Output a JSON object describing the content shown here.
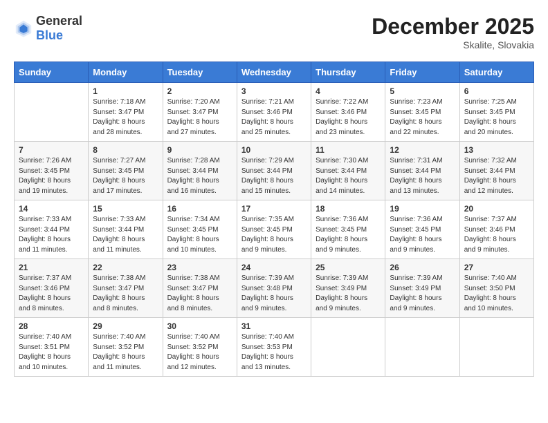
{
  "logo": {
    "general": "General",
    "blue": "Blue"
  },
  "header": {
    "month_year": "December 2025",
    "location": "Skalite, Slovakia"
  },
  "weekdays": [
    "Sunday",
    "Monday",
    "Tuesday",
    "Wednesday",
    "Thursday",
    "Friday",
    "Saturday"
  ],
  "weeks": [
    [
      {
        "day": "",
        "sunrise": "",
        "sunset": "",
        "daylight": ""
      },
      {
        "day": "1",
        "sunrise": "Sunrise: 7:18 AM",
        "sunset": "Sunset: 3:47 PM",
        "daylight": "Daylight: 8 hours and 28 minutes."
      },
      {
        "day": "2",
        "sunrise": "Sunrise: 7:20 AM",
        "sunset": "Sunset: 3:47 PM",
        "daylight": "Daylight: 8 hours and 27 minutes."
      },
      {
        "day": "3",
        "sunrise": "Sunrise: 7:21 AM",
        "sunset": "Sunset: 3:46 PM",
        "daylight": "Daylight: 8 hours and 25 minutes."
      },
      {
        "day": "4",
        "sunrise": "Sunrise: 7:22 AM",
        "sunset": "Sunset: 3:46 PM",
        "daylight": "Daylight: 8 hours and 23 minutes."
      },
      {
        "day": "5",
        "sunrise": "Sunrise: 7:23 AM",
        "sunset": "Sunset: 3:45 PM",
        "daylight": "Daylight: 8 hours and 22 minutes."
      },
      {
        "day": "6",
        "sunrise": "Sunrise: 7:25 AM",
        "sunset": "Sunset: 3:45 PM",
        "daylight": "Daylight: 8 hours and 20 minutes."
      }
    ],
    [
      {
        "day": "7",
        "sunrise": "Sunrise: 7:26 AM",
        "sunset": "Sunset: 3:45 PM",
        "daylight": "Daylight: 8 hours and 19 minutes."
      },
      {
        "day": "8",
        "sunrise": "Sunrise: 7:27 AM",
        "sunset": "Sunset: 3:45 PM",
        "daylight": "Daylight: 8 hours and 17 minutes."
      },
      {
        "day": "9",
        "sunrise": "Sunrise: 7:28 AM",
        "sunset": "Sunset: 3:44 PM",
        "daylight": "Daylight: 8 hours and 16 minutes."
      },
      {
        "day": "10",
        "sunrise": "Sunrise: 7:29 AM",
        "sunset": "Sunset: 3:44 PM",
        "daylight": "Daylight: 8 hours and 15 minutes."
      },
      {
        "day": "11",
        "sunrise": "Sunrise: 7:30 AM",
        "sunset": "Sunset: 3:44 PM",
        "daylight": "Daylight: 8 hours and 14 minutes."
      },
      {
        "day": "12",
        "sunrise": "Sunrise: 7:31 AM",
        "sunset": "Sunset: 3:44 PM",
        "daylight": "Daylight: 8 hours and 13 minutes."
      },
      {
        "day": "13",
        "sunrise": "Sunrise: 7:32 AM",
        "sunset": "Sunset: 3:44 PM",
        "daylight": "Daylight: 8 hours and 12 minutes."
      }
    ],
    [
      {
        "day": "14",
        "sunrise": "Sunrise: 7:33 AM",
        "sunset": "Sunset: 3:44 PM",
        "daylight": "Daylight: 8 hours and 11 minutes."
      },
      {
        "day": "15",
        "sunrise": "Sunrise: 7:33 AM",
        "sunset": "Sunset: 3:44 PM",
        "daylight": "Daylight: 8 hours and 11 minutes."
      },
      {
        "day": "16",
        "sunrise": "Sunrise: 7:34 AM",
        "sunset": "Sunset: 3:45 PM",
        "daylight": "Daylight: 8 hours and 10 minutes."
      },
      {
        "day": "17",
        "sunrise": "Sunrise: 7:35 AM",
        "sunset": "Sunset: 3:45 PM",
        "daylight": "Daylight: 8 hours and 9 minutes."
      },
      {
        "day": "18",
        "sunrise": "Sunrise: 7:36 AM",
        "sunset": "Sunset: 3:45 PM",
        "daylight": "Daylight: 8 hours and 9 minutes."
      },
      {
        "day": "19",
        "sunrise": "Sunrise: 7:36 AM",
        "sunset": "Sunset: 3:45 PM",
        "daylight": "Daylight: 8 hours and 9 minutes."
      },
      {
        "day": "20",
        "sunrise": "Sunrise: 7:37 AM",
        "sunset": "Sunset: 3:46 PM",
        "daylight": "Daylight: 8 hours and 9 minutes."
      }
    ],
    [
      {
        "day": "21",
        "sunrise": "Sunrise: 7:37 AM",
        "sunset": "Sunset: 3:46 PM",
        "daylight": "Daylight: 8 hours and 8 minutes."
      },
      {
        "day": "22",
        "sunrise": "Sunrise: 7:38 AM",
        "sunset": "Sunset: 3:47 PM",
        "daylight": "Daylight: 8 hours and 8 minutes."
      },
      {
        "day": "23",
        "sunrise": "Sunrise: 7:38 AM",
        "sunset": "Sunset: 3:47 PM",
        "daylight": "Daylight: 8 hours and 8 minutes."
      },
      {
        "day": "24",
        "sunrise": "Sunrise: 7:39 AM",
        "sunset": "Sunset: 3:48 PM",
        "daylight": "Daylight: 8 hours and 9 minutes."
      },
      {
        "day": "25",
        "sunrise": "Sunrise: 7:39 AM",
        "sunset": "Sunset: 3:49 PM",
        "daylight": "Daylight: 8 hours and 9 minutes."
      },
      {
        "day": "26",
        "sunrise": "Sunrise: 7:39 AM",
        "sunset": "Sunset: 3:49 PM",
        "daylight": "Daylight: 8 hours and 9 minutes."
      },
      {
        "day": "27",
        "sunrise": "Sunrise: 7:40 AM",
        "sunset": "Sunset: 3:50 PM",
        "daylight": "Daylight: 8 hours and 10 minutes."
      }
    ],
    [
      {
        "day": "28",
        "sunrise": "Sunrise: 7:40 AM",
        "sunset": "Sunset: 3:51 PM",
        "daylight": "Daylight: 8 hours and 10 minutes."
      },
      {
        "day": "29",
        "sunrise": "Sunrise: 7:40 AM",
        "sunset": "Sunset: 3:52 PM",
        "daylight": "Daylight: 8 hours and 11 minutes."
      },
      {
        "day": "30",
        "sunrise": "Sunrise: 7:40 AM",
        "sunset": "Sunset: 3:52 PM",
        "daylight": "Daylight: 8 hours and 12 minutes."
      },
      {
        "day": "31",
        "sunrise": "Sunrise: 7:40 AM",
        "sunset": "Sunset: 3:53 PM",
        "daylight": "Daylight: 8 hours and 13 minutes."
      },
      {
        "day": "",
        "sunrise": "",
        "sunset": "",
        "daylight": ""
      },
      {
        "day": "",
        "sunrise": "",
        "sunset": "",
        "daylight": ""
      },
      {
        "day": "",
        "sunrise": "",
        "sunset": "",
        "daylight": ""
      }
    ]
  ]
}
